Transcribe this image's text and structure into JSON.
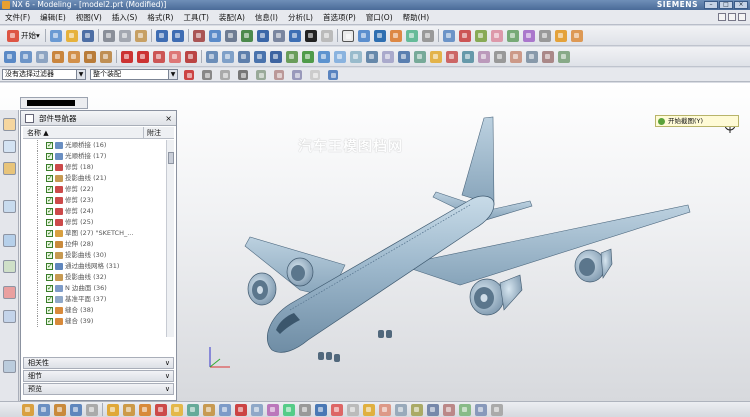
{
  "window": {
    "title": "NX 6 - Modeling - [model2.prt (Modified)]",
    "brand": "SIEMENS"
  },
  "menus": [
    "文件(F)",
    "编辑(E)",
    "视图(V)",
    "插入(S)",
    "格式(R)",
    "工具(T)",
    "装配(A)",
    "信息(I)",
    "分析(L)",
    "首选项(P)",
    "窗口(O)",
    "帮助(H)"
  ],
  "toolbar": {
    "start_label": "开始"
  },
  "filters": {
    "type_filter": "没有选择过滤器",
    "scope": "整个装配"
  },
  "navigator": {
    "title": "部件导航器",
    "col_name": "名称",
    "col_attach": "附注",
    "items": [
      "光顺桥接 (16)",
      "光顺桥接 (17)",
      "修剪 (18)",
      "投影曲线 (21)",
      "修剪 (22)",
      "修剪 (23)",
      "修剪 (24)",
      "修剪 (25)",
      "草图 (27) \"SKETCH_...",
      "拉伸 (28)",
      "投影曲线 (30)",
      "通过曲线网格 (31)",
      "投影曲线 (32)",
      "N 边曲面 (36)",
      "基准平面 (37)",
      "缝合 (38)",
      "缝合 (39)"
    ],
    "sections": [
      "相关性",
      "细节",
      "预览"
    ]
  },
  "graphics": {
    "watermark": "汽车王模图档网",
    "hint": "开始截图(Y)"
  },
  "colors": {
    "aircraft_body": "#9db8cc",
    "viewport_top": "#ffffff",
    "viewport_bottom": "#d7d9dd",
    "check_green": "#2d7a18"
  },
  "icons": [
    "start-icon",
    "new-icon",
    "open-icon",
    "save-icon",
    "cut-icon",
    "copy-icon",
    "paste-icon",
    "undo-icon",
    "redo-icon",
    "fit-icon",
    "zoom-icon",
    "rotate-icon",
    "shading-icon",
    "line-icon",
    "arc-icon",
    "sketch-icon",
    "extrude-icon",
    "blend-icon"
  ]
}
